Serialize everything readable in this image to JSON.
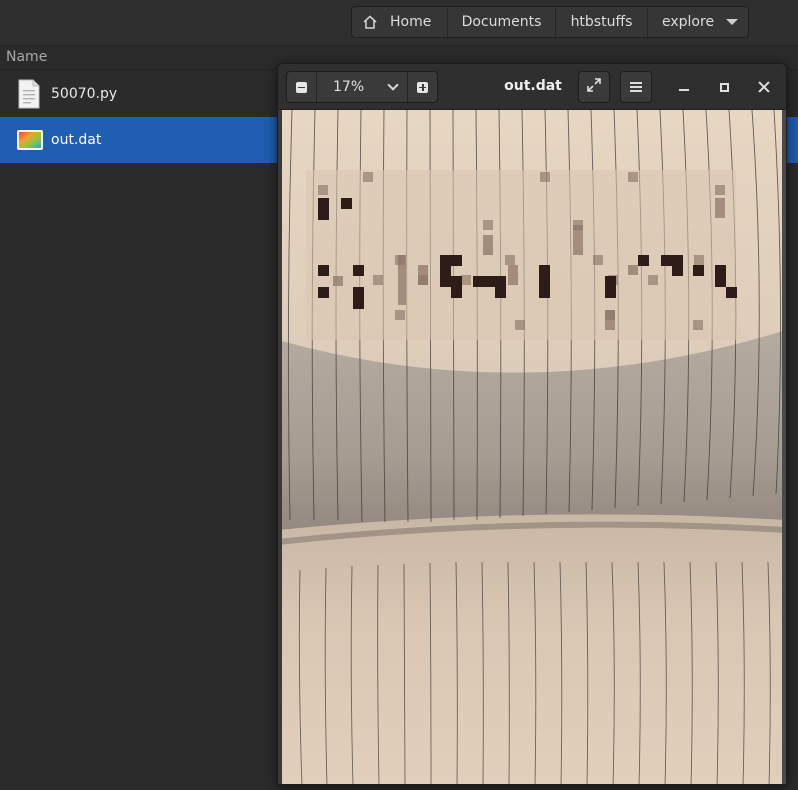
{
  "breadcrumb": {
    "home": "Home",
    "documents": "Documents",
    "htbstuffs": "htbstuffs",
    "explore": "explore"
  },
  "columns": {
    "name": "Name"
  },
  "files": [
    {
      "name": "50070.py",
      "icon": "text-file-icon",
      "selected": false
    },
    {
      "name": "out.dat",
      "icon": "image-file-icon",
      "selected": true
    }
  ],
  "viewer": {
    "title": "out.dat",
    "zoom": "17%"
  },
  "colors": {
    "selection": "#1f5eb0",
    "background": "#2b2b2b",
    "paper": "#e8dccd"
  }
}
